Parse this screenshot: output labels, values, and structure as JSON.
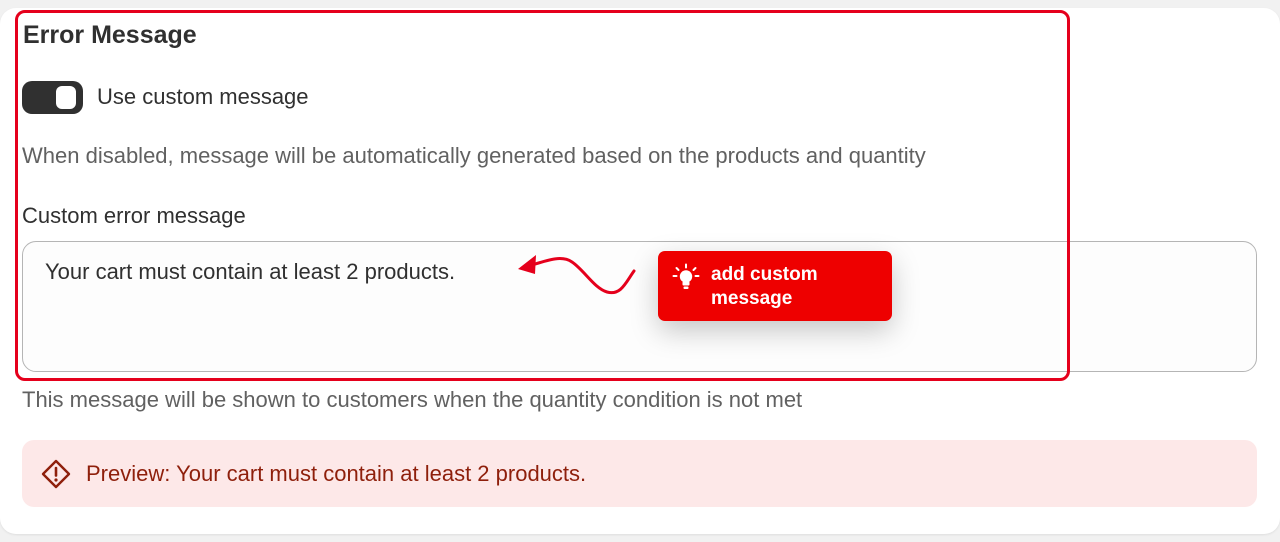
{
  "section": {
    "title": "Error Message",
    "toggle_label": "Use custom message",
    "toggle_on": true,
    "help_text": "When disabled, message will be automatically generated based on the products and quantity",
    "field_label": "Custom error message",
    "field_value": "Your cart must contain at least 2 products.",
    "field_help": "This message will be shown to customers when the quantity condition is not met",
    "preview_text": "Preview: Your cart must contain at least 2 products."
  },
  "annotation": {
    "tip_text": "add custom message",
    "accent_color": "#e5001c"
  },
  "colors": {
    "preview_bg": "#fde8e8",
    "preview_text": "#8e1f0b",
    "toggle_on": "#303030"
  },
  "icons": {
    "preview": "alert-diamond-icon",
    "tip": "lightbulb-icon"
  }
}
